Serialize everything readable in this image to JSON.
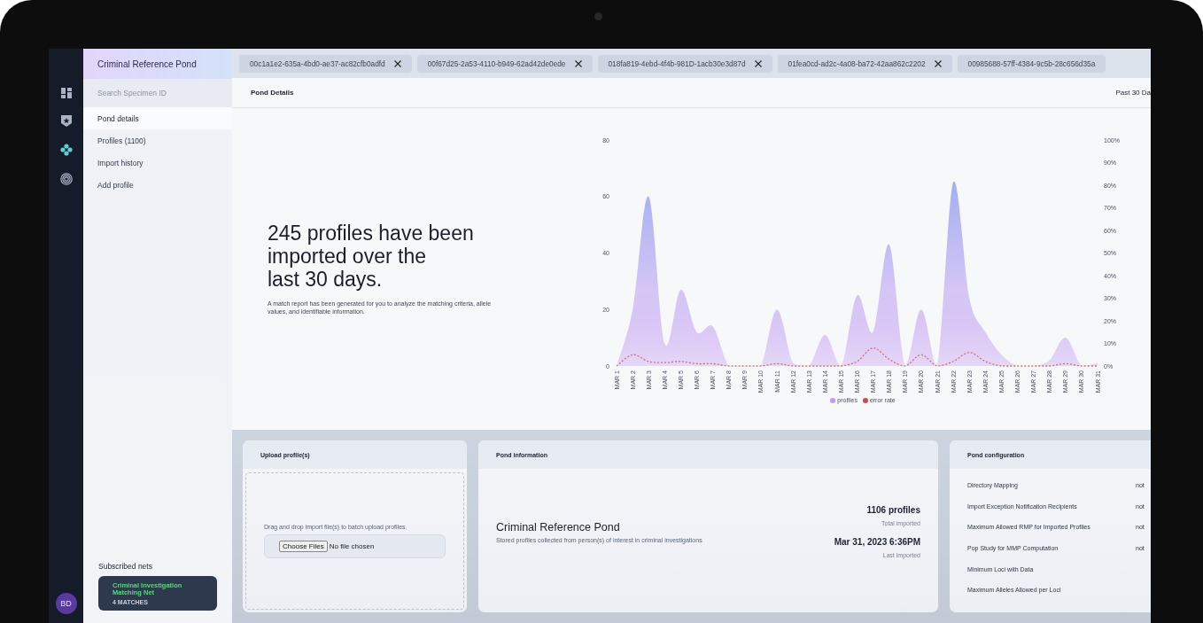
{
  "rail": {
    "avatar": "BD"
  },
  "sidebar": {
    "title": "Criminal Reference Pond",
    "search": {
      "placeholder": "Search Specimen ID"
    },
    "items": [
      {
        "label": "Pond details",
        "selected": true
      },
      {
        "label": "Profiles (1100)",
        "selected": false
      },
      {
        "label": "Import history",
        "selected": false
      },
      {
        "label": "Add profile",
        "selected": false
      }
    ],
    "subscribed": {
      "heading": "Subscribed nets",
      "nets": [
        {
          "name": "Criminal Investigation Matching Net",
          "matches": "4 MATCHES"
        }
      ]
    }
  },
  "tabs": [
    {
      "label": "00c1a1e2-635a-4bd0-ae37-ac82cfb0adfd",
      "selected": false,
      "closable": true
    },
    {
      "label": "00f67d25-2a53-4110-b949-62ad42de0ede",
      "selected": false,
      "closable": true
    },
    {
      "label": "018fa819-4ebd-4f4b-981D-1acb30e3d87d",
      "selected": false,
      "closable": true
    },
    {
      "label": "01fea0cd-ad2c-4a08-ba72-42aa862c2202",
      "selected": false,
      "closable": true
    },
    {
      "label": "00985688-57ff-4384-9c5b-28c656d35a",
      "selected": false,
      "closable": false
    }
  ],
  "main": {
    "title": "Pond Details",
    "range": "Past 30 Da",
    "headline": "245 profiles have been\nimported over the\nlast 30 days.",
    "description": "A match report has been generated for you to analyze the matching criteria, allele values, and identifiable information.",
    "chart": {
      "chart_data": {
        "type": "area",
        "categories": [
          "MAR 1",
          "MAR 2",
          "MAR 3",
          "MAR 4",
          "MAR 5",
          "MAR 6",
          "MAR 7",
          "MAR 8",
          "MAR 9",
          "MAR 10",
          "MAR 11",
          "MAR 12",
          "MAR 13",
          "MAR 14",
          "MAR 15",
          "MAR 16",
          "MAR 17",
          "MAR 18",
          "MAR 19",
          "MAR 20",
          "MAR 21",
          "MAR 22",
          "MAR 23",
          "MAR 24",
          "MAR 25",
          "MAR 26",
          "MAR 27",
          "MAR 28",
          "MAR 29",
          "MAR 30",
          "MAR 31"
        ],
        "ylim": [
          0,
          80
        ],
        "yticks": [
          0,
          20,
          40,
          60,
          80
        ],
        "series": [
          {
            "name": "profiles",
            "color": "#c49bf2",
            "values": [
              0,
              20,
              60,
              8,
              27,
              12,
              14,
              0,
              0,
              0,
              20,
              1,
              0,
              11,
              0,
              25,
              12,
              43,
              0,
              20,
              0,
              65,
              24,
              12,
              4,
              0,
              0,
              2,
              10,
              0,
              1
            ]
          },
          {
            "name": "error rate",
            "color": "#d24a4a",
            "axis": "y2",
            "type": "line",
            "line_style": "dashed",
            "values": [
              0,
              5,
              2,
              1.5,
              2,
              1,
              1,
              0,
              0,
              0,
              1,
              0,
              0,
              0,
              0,
              2,
              8,
              3,
              0,
              5,
              0,
              2,
              6,
              2,
              0,
              0,
              0,
              0,
              1,
              0,
              0
            ]
          }
        ],
        "y2lim": [
          0,
          100
        ],
        "y2ticks": [
          {
            "value": 0,
            "label": "0%"
          },
          {
            "value": 10,
            "label": "10%"
          },
          {
            "value": 20,
            "label": "20%"
          },
          {
            "value": 30,
            "label": "30%"
          },
          {
            "value": 40,
            "label": "40%"
          },
          {
            "value": 50,
            "label": "50%"
          },
          {
            "value": 60,
            "label": "60%"
          },
          {
            "value": 70,
            "label": "70%"
          },
          {
            "value": 80,
            "label": "80%"
          },
          {
            "value": 90,
            "label": "90%"
          },
          {
            "value": 100,
            "label": "100%"
          }
        ],
        "legend": "bottom"
      }
    }
  },
  "cards": {
    "upload": {
      "title": "Upload profile(s)",
      "hint": "Drag and drop import file(s) to batch upload profiles.",
      "button": "Choose Files",
      "status": "No file chosen"
    },
    "info": {
      "title": "Pond information",
      "name": "Criminal Reference Pond",
      "description": "Stored profiles collected from person(s) of interest in criminal investigations",
      "stats": [
        {
          "value": "1106 profiles",
          "label": "Total imported"
        },
        {
          "value": "Mar 31, 2023 6:36PM",
          "label": "Last imported"
        }
      ]
    },
    "config": {
      "title": "Pond configuration",
      "rows": [
        {
          "label": "Directory Mapping",
          "value": "not"
        },
        {
          "label": "Import Exception Notification Recipients",
          "value": "not"
        },
        {
          "label": "Maximum Allowed RMP for Imported Profiles",
          "value": "not"
        },
        {
          "label": "Pop Study for MMP Computation",
          "value": "not"
        },
        {
          "label": "Minimum Loci with Data"
        },
        {
          "label": "Maximum Alleles Allowed per Loci"
        }
      ]
    }
  }
}
